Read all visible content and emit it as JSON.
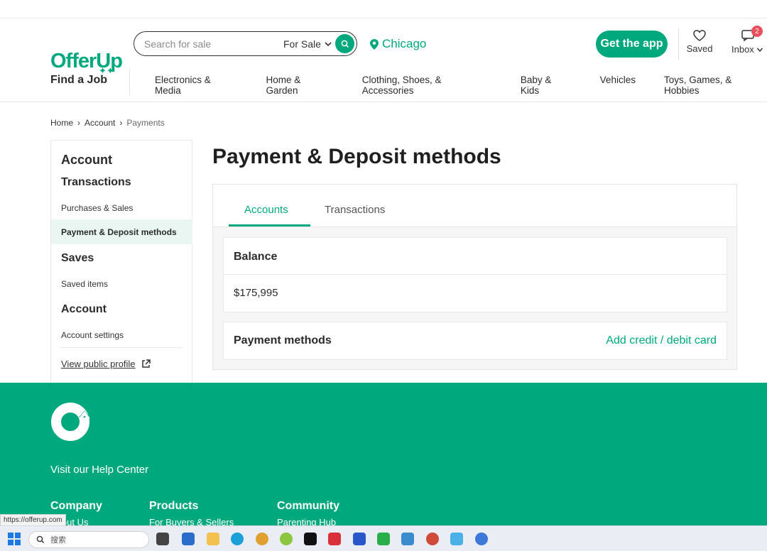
{
  "header": {
    "logo": "OfferUp",
    "search": {
      "placeholder": "Search for sale",
      "filter": "For Sale"
    },
    "location": "Chicago",
    "get_app": "Get the app",
    "saved": "Saved",
    "inbox": "Inbox",
    "inbox_badge": "2",
    "find_job": "Find a Job",
    "categories": [
      "Electronics & Media",
      "Home & Garden",
      "Clothing, Shoes, & Accessories",
      "Baby & Kids",
      "Vehicles",
      "Toys, Games, & Hobbies"
    ]
  },
  "breadcrumb": [
    "Home",
    "Account",
    "Payments"
  ],
  "sidebar": {
    "title": "Account",
    "sections": [
      {
        "heading": "Transactions",
        "items": [
          "Purchases & Sales",
          "Payment & Deposit methods"
        ]
      },
      {
        "heading": "Saves",
        "items": [
          "Saved items"
        ]
      },
      {
        "heading": "Account",
        "items": [
          "Account settings"
        ]
      }
    ],
    "profile_link": "View public profile"
  },
  "main": {
    "title": "Payment & Deposit methods",
    "tabs": [
      "Accounts",
      "Transactions"
    ],
    "balance_label": "Balance",
    "balance_value": "$175,995",
    "payment_methods_label": "Payment methods",
    "add_card": "Add credit / debit card"
  },
  "footer": {
    "help": "Visit our Help Center",
    "columns": [
      {
        "title": "Company",
        "first": "About Us"
      },
      {
        "title": "Products",
        "first": "For Buyers & Sellers"
      },
      {
        "title": "Community",
        "first": "Parenting Hub"
      }
    ]
  },
  "status_url": "https://offerup.com",
  "taskbar": {
    "search": "搜索"
  },
  "colors": {
    "brand": "#00a87e",
    "active_bg": "#e9f6f1",
    "badge": "#e8505b"
  }
}
